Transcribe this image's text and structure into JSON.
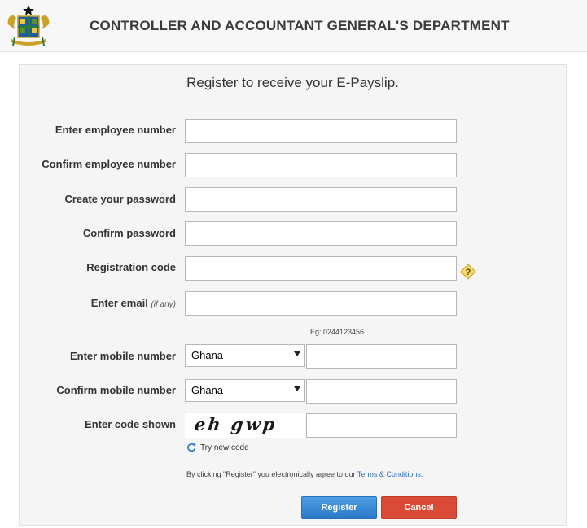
{
  "header": {
    "title": "CONTROLLER AND ACCOUNTANT GENERAL'S DEPARTMENT"
  },
  "form": {
    "title": "Register to receive your E-Payslip.",
    "fields": {
      "employee_number": {
        "label": "Enter employee number",
        "value": ""
      },
      "confirm_employee_number": {
        "label": "Confirm employee number",
        "value": ""
      },
      "password": {
        "label": "Create your password",
        "value": ""
      },
      "confirm_password": {
        "label": "Confirm password",
        "value": ""
      },
      "registration_code": {
        "label": "Registration code",
        "value": ""
      },
      "email": {
        "label": "Enter email",
        "hint": "(if any)",
        "value": ""
      },
      "mobile": {
        "label": "Enter mobile number",
        "country": "Ghana",
        "value": ""
      },
      "confirm_mobile": {
        "label": "Confirm mobile number",
        "country": "Ghana",
        "value": ""
      },
      "captcha": {
        "label": "Enter code shown",
        "code_image_text": "eh gwp",
        "value": ""
      }
    },
    "mobile_example": "Eg: 0244123456",
    "try_new_code": "Try new code",
    "agreement_prefix": "By clicking \"Register\" you electronically agree to our",
    "agreement_link": "Terms & Conditions",
    "agreement_suffix": ".",
    "register_label": "Register",
    "cancel_label": "Cancel"
  },
  "colors": {
    "register_button": "#3a8ad6",
    "cancel_button": "#d94a37",
    "link": "#2a6db5",
    "help_badge": "#f5d76e"
  },
  "icons": [
    "ghana-coat-of-arms-logo",
    "help-icon",
    "refresh-icon",
    "chevron-down-icon"
  ]
}
